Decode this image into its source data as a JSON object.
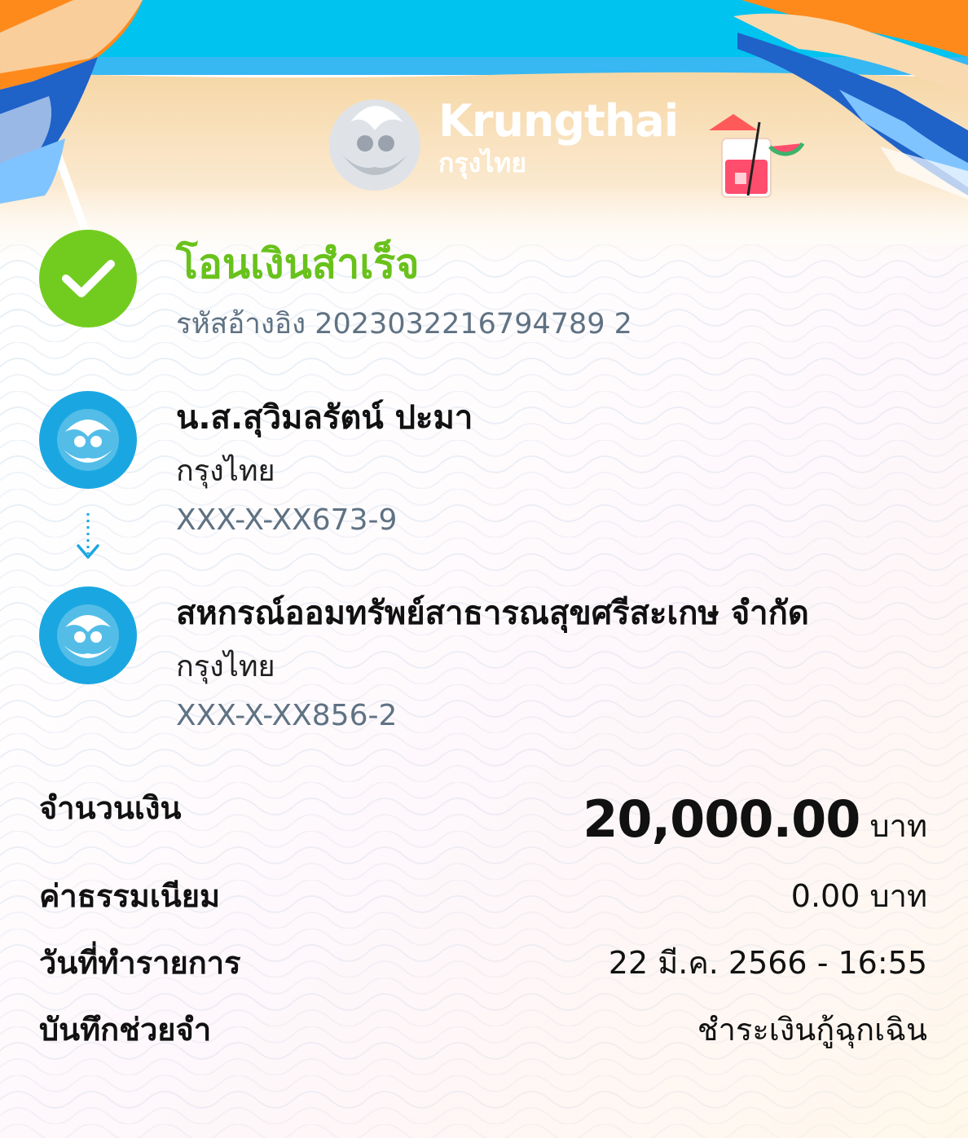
{
  "brand": {
    "name_en": "Krungthai",
    "name_th": "กรุงไทย",
    "colors": {
      "primary": "#00a3e0",
      "success": "#69c21b",
      "muted": "#5f7283",
      "sky": "#00c3f0",
      "sand": "#f6d7a6"
    }
  },
  "status": {
    "icon": "check-circle-icon",
    "title": "โอนเงินสำเร็จ",
    "reference_label": "รหัสอ้างอิง",
    "reference_no": "2023032216794789 2"
  },
  "from": {
    "icon": "krungthai-bank-icon",
    "name": "น.ส.สุวิมลรัตน์ ปะมา",
    "bank": "กรุงไทย",
    "account": "XXX-X-XX673-9"
  },
  "transfer_arrow_icon": "arrow-down-icon",
  "to": {
    "icon": "krungthai-bank-icon",
    "name": "สหกรณ์ออมทรัพย์สาธารณสุขศรีสะเกษ จำกัด",
    "bank": "กรุงไทย",
    "account": "XXX-X-XX856-2"
  },
  "details": {
    "amount": {
      "label": "จำนวนเงิน",
      "value": "20,000.00",
      "unit": "บาท"
    },
    "fee": {
      "label": "ค่าธรรมเนียม",
      "value": "0.00 บาท"
    },
    "date": {
      "label": "วันที่ทำรายการ",
      "value": "22 มี.ค. 2566 - 16:55"
    },
    "memo": {
      "label": "บันทึกช่วยจำ",
      "value": "ชำระเงินกู้ฉุกเฉิน"
    }
  }
}
